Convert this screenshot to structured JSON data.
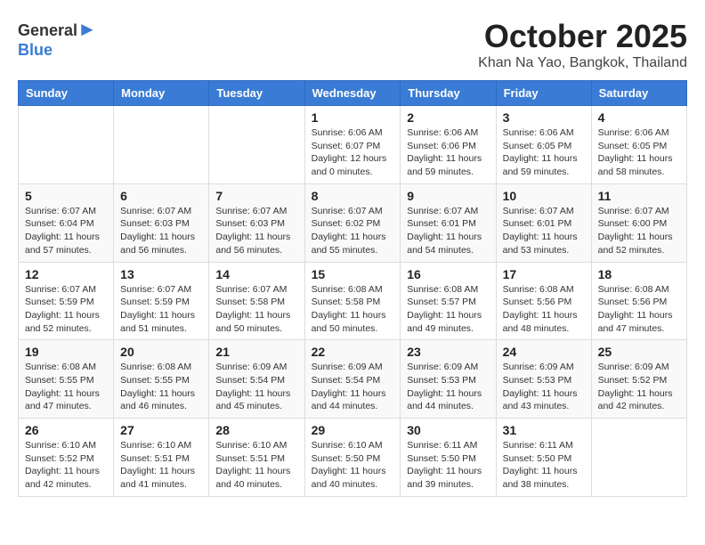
{
  "header": {
    "logo_general": "General",
    "logo_blue": "Blue",
    "month": "October 2025",
    "location": "Khan Na Yao, Bangkok, Thailand"
  },
  "calendar": {
    "weekdays": [
      "Sunday",
      "Monday",
      "Tuesday",
      "Wednesday",
      "Thursday",
      "Friday",
      "Saturday"
    ],
    "weeks": [
      [
        {
          "day": "",
          "info": ""
        },
        {
          "day": "",
          "info": ""
        },
        {
          "day": "",
          "info": ""
        },
        {
          "day": "1",
          "info": "Sunrise: 6:06 AM\nSunset: 6:07 PM\nDaylight: 12 hours\nand 0 minutes."
        },
        {
          "day": "2",
          "info": "Sunrise: 6:06 AM\nSunset: 6:06 PM\nDaylight: 11 hours\nand 59 minutes."
        },
        {
          "day": "3",
          "info": "Sunrise: 6:06 AM\nSunset: 6:05 PM\nDaylight: 11 hours\nand 59 minutes."
        },
        {
          "day": "4",
          "info": "Sunrise: 6:06 AM\nSunset: 6:05 PM\nDaylight: 11 hours\nand 58 minutes."
        }
      ],
      [
        {
          "day": "5",
          "info": "Sunrise: 6:07 AM\nSunset: 6:04 PM\nDaylight: 11 hours\nand 57 minutes."
        },
        {
          "day": "6",
          "info": "Sunrise: 6:07 AM\nSunset: 6:03 PM\nDaylight: 11 hours\nand 56 minutes."
        },
        {
          "day": "7",
          "info": "Sunrise: 6:07 AM\nSunset: 6:03 PM\nDaylight: 11 hours\nand 56 minutes."
        },
        {
          "day": "8",
          "info": "Sunrise: 6:07 AM\nSunset: 6:02 PM\nDaylight: 11 hours\nand 55 minutes."
        },
        {
          "day": "9",
          "info": "Sunrise: 6:07 AM\nSunset: 6:01 PM\nDaylight: 11 hours\nand 54 minutes."
        },
        {
          "day": "10",
          "info": "Sunrise: 6:07 AM\nSunset: 6:01 PM\nDaylight: 11 hours\nand 53 minutes."
        },
        {
          "day": "11",
          "info": "Sunrise: 6:07 AM\nSunset: 6:00 PM\nDaylight: 11 hours\nand 52 minutes."
        }
      ],
      [
        {
          "day": "12",
          "info": "Sunrise: 6:07 AM\nSunset: 5:59 PM\nDaylight: 11 hours\nand 52 minutes."
        },
        {
          "day": "13",
          "info": "Sunrise: 6:07 AM\nSunset: 5:59 PM\nDaylight: 11 hours\nand 51 minutes."
        },
        {
          "day": "14",
          "info": "Sunrise: 6:07 AM\nSunset: 5:58 PM\nDaylight: 11 hours\nand 50 minutes."
        },
        {
          "day": "15",
          "info": "Sunrise: 6:08 AM\nSunset: 5:58 PM\nDaylight: 11 hours\nand 50 minutes."
        },
        {
          "day": "16",
          "info": "Sunrise: 6:08 AM\nSunset: 5:57 PM\nDaylight: 11 hours\nand 49 minutes."
        },
        {
          "day": "17",
          "info": "Sunrise: 6:08 AM\nSunset: 5:56 PM\nDaylight: 11 hours\nand 48 minutes."
        },
        {
          "day": "18",
          "info": "Sunrise: 6:08 AM\nSunset: 5:56 PM\nDaylight: 11 hours\nand 47 minutes."
        }
      ],
      [
        {
          "day": "19",
          "info": "Sunrise: 6:08 AM\nSunset: 5:55 PM\nDaylight: 11 hours\nand 47 minutes."
        },
        {
          "day": "20",
          "info": "Sunrise: 6:08 AM\nSunset: 5:55 PM\nDaylight: 11 hours\nand 46 minutes."
        },
        {
          "day": "21",
          "info": "Sunrise: 6:09 AM\nSunset: 5:54 PM\nDaylight: 11 hours\nand 45 minutes."
        },
        {
          "day": "22",
          "info": "Sunrise: 6:09 AM\nSunset: 5:54 PM\nDaylight: 11 hours\nand 44 minutes."
        },
        {
          "day": "23",
          "info": "Sunrise: 6:09 AM\nSunset: 5:53 PM\nDaylight: 11 hours\nand 44 minutes."
        },
        {
          "day": "24",
          "info": "Sunrise: 6:09 AM\nSunset: 5:53 PM\nDaylight: 11 hours\nand 43 minutes."
        },
        {
          "day": "25",
          "info": "Sunrise: 6:09 AM\nSunset: 5:52 PM\nDaylight: 11 hours\nand 42 minutes."
        }
      ],
      [
        {
          "day": "26",
          "info": "Sunrise: 6:10 AM\nSunset: 5:52 PM\nDaylight: 11 hours\nand 42 minutes."
        },
        {
          "day": "27",
          "info": "Sunrise: 6:10 AM\nSunset: 5:51 PM\nDaylight: 11 hours\nand 41 minutes."
        },
        {
          "day": "28",
          "info": "Sunrise: 6:10 AM\nSunset: 5:51 PM\nDaylight: 11 hours\nand 40 minutes."
        },
        {
          "day": "29",
          "info": "Sunrise: 6:10 AM\nSunset: 5:50 PM\nDaylight: 11 hours\nand 40 minutes."
        },
        {
          "day": "30",
          "info": "Sunrise: 6:11 AM\nSunset: 5:50 PM\nDaylight: 11 hours\nand 39 minutes."
        },
        {
          "day": "31",
          "info": "Sunrise: 6:11 AM\nSunset: 5:50 PM\nDaylight: 11 hours\nand 38 minutes."
        },
        {
          "day": "",
          "info": ""
        }
      ]
    ]
  }
}
